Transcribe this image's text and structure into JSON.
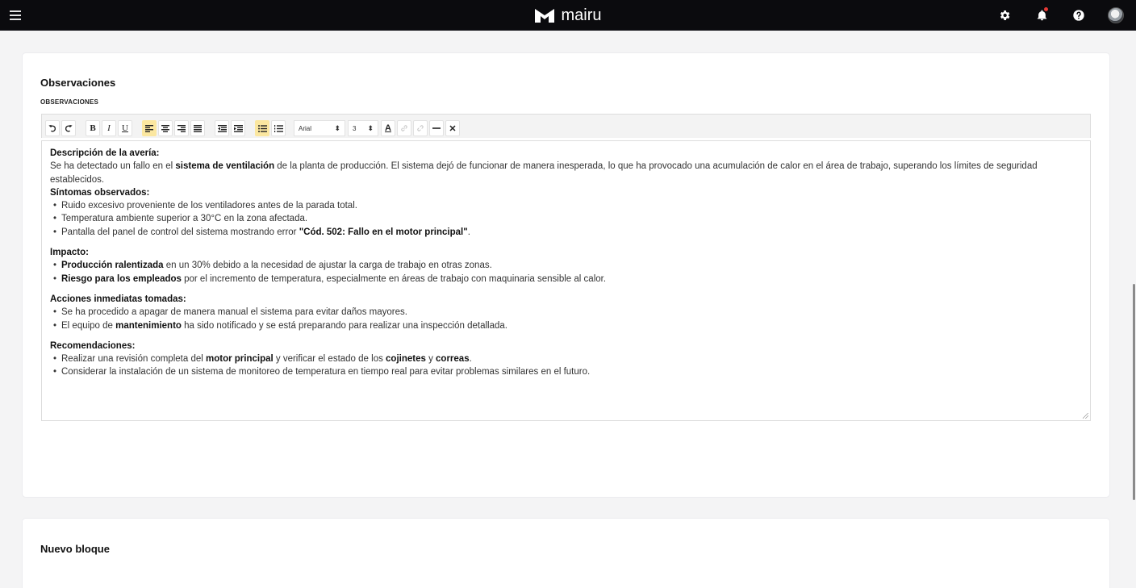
{
  "header": {
    "brand": "mairu",
    "icons": [
      "menu-icon",
      "gear-icon",
      "bell-icon",
      "help-icon",
      "avatar"
    ]
  },
  "observaciones_card": {
    "title": "Observaciones",
    "field_label": "OBSERVACIONES",
    "toolbar": {
      "font_family": "Arial",
      "font_size": "3"
    },
    "content": {
      "desc_heading": "Descripción de la avería:",
      "desc_p1": "Se ha detectado un fallo en el ",
      "desc_b1": "sistema de ventilación",
      "desc_p2": " de la planta de producción. El sistema dejó de funcionar de manera inesperada, lo que ha provocado una acumulación de calor en el área de trabajo, superando los límites de seguridad establecidos.",
      "sint_heading": "Síntomas observados:",
      "sint_1": "Ruido excesivo proveniente de los ventiladores antes de la parada total.",
      "sint_2": "Temperatura ambiente superior a 30°C en la zona afectada.",
      "sint_3a": "Pantalla del panel de control del sistema mostrando error ",
      "sint_3b": "\"Cód. 502: Fallo en el motor principal\"",
      "sint_3c": ".",
      "imp_heading": "Impacto:",
      "imp_1b": "Producción ralentizada",
      "imp_1t": " en un 30% debido a la necesidad de ajustar la carga de trabajo en otras zonas.",
      "imp_2b": "Riesgo para los empleados",
      "imp_2t": " por el incremento de temperatura, especialmente en áreas de trabajo con maquinaria sensible al calor.",
      "acc_heading": "Acciones inmediatas tomadas:",
      "acc_1": "Se ha procedido a apagar de manera manual el sistema para evitar daños mayores.",
      "acc_2a": "El equipo de ",
      "acc_2b": "mantenimiento",
      "acc_2c": " ha sido notificado y se está preparando para realizar una inspección detallada.",
      "rec_heading": "Recomendaciones:",
      "rec_1a": "Realizar una revisión completa del ",
      "rec_1b": "motor principal",
      "rec_1c": " y verificar el estado de los ",
      "rec_1d": "cojinetes",
      "rec_1e": " y ",
      "rec_1f": "correas",
      "rec_1g": ".",
      "rec_2": "Considerar la instalación de un sistema de monitoreo de temperatura en tiempo real para evitar problemas similares en el futuro."
    }
  },
  "nuevo_card": {
    "title": "Nuevo bloque"
  },
  "colors": {
    "topbar": "#0b0b0e",
    "toolbar_active": "#fbe7a0",
    "notification_dot": "#e53935"
  }
}
